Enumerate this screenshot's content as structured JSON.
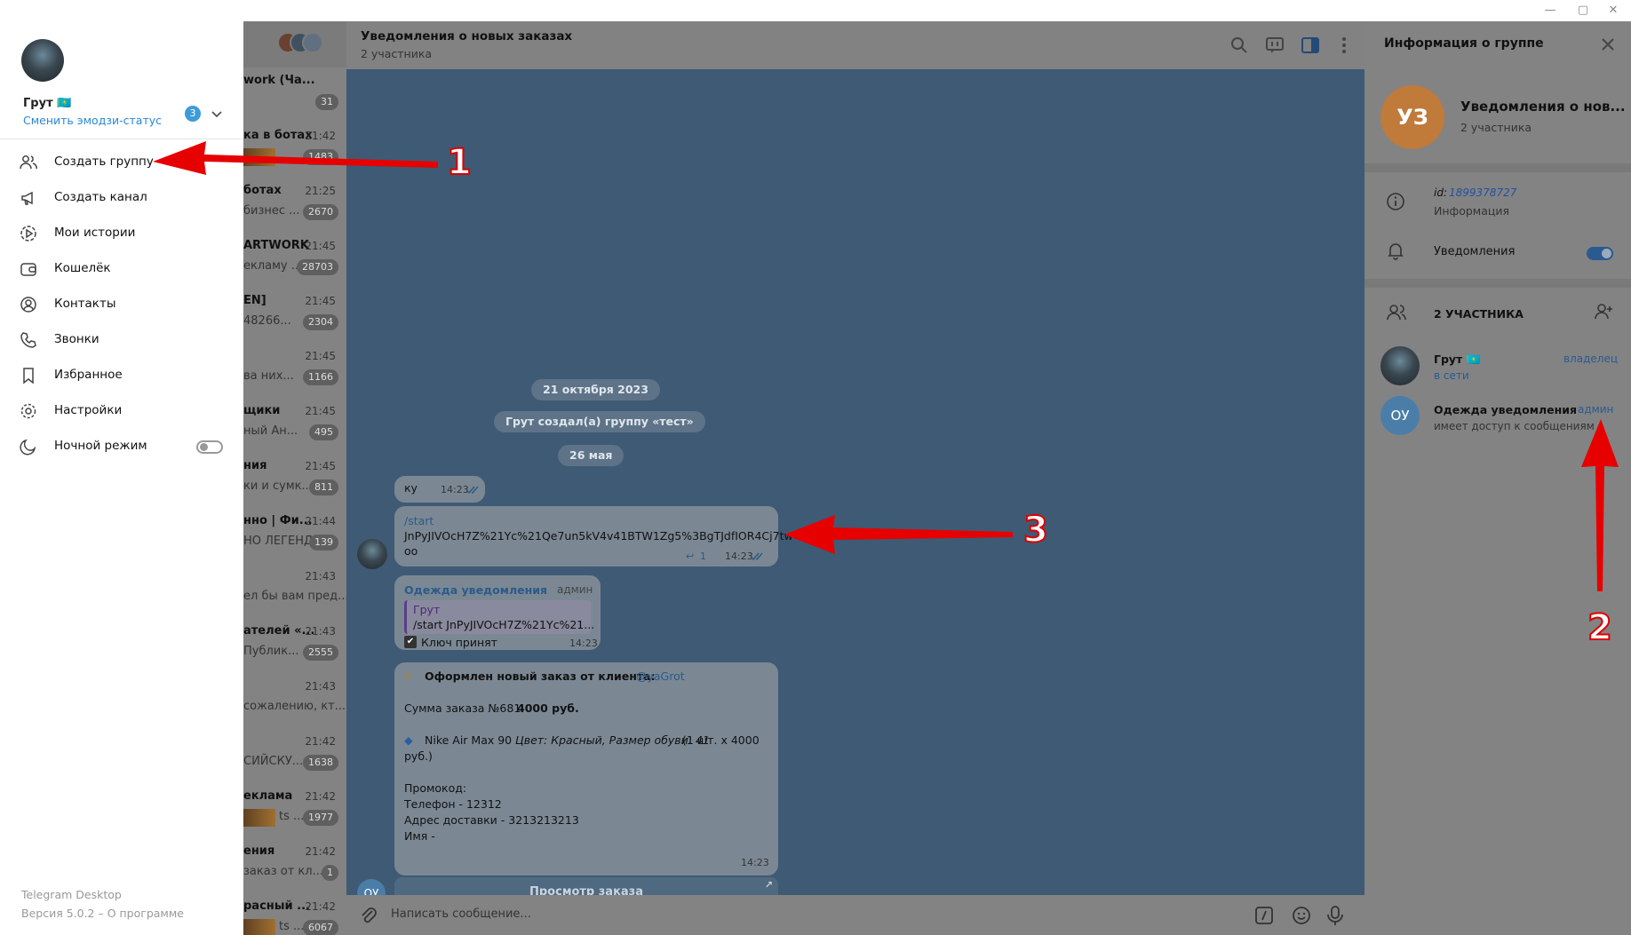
{
  "drawer": {
    "user_name": "Грут 🇰🇿",
    "emoji_status_link": "Сменить эмодзи-статус",
    "accounts_badge": "3",
    "menu": [
      {
        "label": "Создать группу"
      },
      {
        "label": "Создать канал"
      },
      {
        "label": "Мои истории"
      },
      {
        "label": "Кошелёк"
      },
      {
        "label": "Контакты"
      },
      {
        "label": "Звонки"
      },
      {
        "label": "Избранное"
      },
      {
        "label": "Настройки"
      },
      {
        "label": "Ночной режим"
      }
    ],
    "app_name": "Telegram Desktop",
    "version": "Версия 5.0.2 – О программе"
  },
  "chatlist": {
    "items": [
      {
        "name": "work (Ча...",
        "time": "",
        "preview": "",
        "badge": "31"
      },
      {
        "name": "ка в ботах",
        "time": "21:42",
        "preview": "",
        "badge": "1483"
      },
      {
        "name": "ботах",
        "time": "21:25",
        "preview": "бизнес ...",
        "badge": "2670"
      },
      {
        "name": "ARTWORK",
        "time": "21:45",
        "preview": "екламу ...",
        "badge": "28703"
      },
      {
        "name": "EN]",
        "time": "21:45",
        "preview": "48266...",
        "badge": "2304"
      },
      {
        "name": "",
        "time": "21:45",
        "preview": "ва них...",
        "badge": "1166"
      },
      {
        "name": "щики",
        "time": "21:45",
        "preview": "ный Ан...",
        "badge": "495"
      },
      {
        "name": "ния",
        "time": "21:45",
        "preview": "ки и сумк...",
        "badge": "811"
      },
      {
        "name": "нно | Фи...",
        "time": "21:44",
        "preview": "НО ЛЕГЕНД...",
        "badge": "139"
      },
      {
        "name": "",
        "time": "21:43",
        "preview": "ел бы вам пред...",
        "badge": ""
      },
      {
        "name": "ателей «...",
        "time": "21:43",
        "preview": "Публик...",
        "badge": "2555"
      },
      {
        "name": "",
        "time": "21:43",
        "preview": "сожалению, кт...",
        "badge": ""
      },
      {
        "name": "",
        "time": "21:42",
        "preview": "СИЙСКУ...",
        "badge": "1638"
      },
      {
        "name": "еклама",
        "time": "21:42",
        "preview": "ts ...",
        "badge": "1977"
      },
      {
        "name": "ения",
        "time": "21:42",
        "preview": "заказ от кл...",
        "badge": "1"
      },
      {
        "name": "расный ...",
        "time": "21:42",
        "preview": "ts ...",
        "badge": "6067"
      }
    ]
  },
  "chat": {
    "title": "Уведомления о новых заказах",
    "subtitle": "2 участника",
    "date1": "21 октября 2023",
    "service": "Грут создал(а) группу «тест»",
    "date2": "26 мая",
    "msg1": {
      "text": "ку",
      "time": "14:23"
    },
    "msg2": {
      "command": "/start",
      "line1": "JnPyJIVOcH7Z%21Yc%21Qe7un5kV4v41BTW1Zg5%3BgTJdfIOR4Cj7tw",
      "line2": "oo",
      "replies": "1",
      "time": "14:23"
    },
    "msg3": {
      "author": "Одежда уведомления",
      "role": "админ",
      "quote_author": "Грут",
      "quote_text": "/start JnPyJIVOcH7Z%21Yc%21...",
      "text": "Ключ принят",
      "time": "14:23"
    },
    "msg4": {
      "line_title": "Оформлен новый заказ от клиента:",
      "mention": "@yaGrot",
      "line_sum_label": "Сумма заказа №681:",
      "line_sum_value": "4000 руб.",
      "item_name": "Nike Air Max 90",
      "item_attrs": "Цвет: Красный, Размер обуви: 41",
      "item_qty": "(1 шт. x 4000",
      "item_qty2": "руб.)",
      "promo": "Промокод:",
      "phone": "Телефон - 12312",
      "address": "Адрес доставки - 3213213213",
      "name": "Имя -",
      "time": "14:23",
      "button": "Просмотр заказа"
    },
    "sender_avatar": "ОУ",
    "composer_placeholder": "Написать сообщение..."
  },
  "info": {
    "title": "Информация о группе",
    "avatar_initials": "УЗ",
    "group_name": "Уведомления о нов...",
    "group_sub": "2 участника",
    "id_label": "id:",
    "id_value": "1899378727",
    "info_label": "Информация",
    "notifications_label": "Уведомления",
    "members_header": "2 УЧАСТНИКА",
    "members": [
      {
        "name": "Грут 🇰🇿",
        "status": "в сети",
        "role": "владелец"
      },
      {
        "name": "Одежда уведомления",
        "status": "имеет доступ к сообщениям",
        "role": "админ",
        "initials": "ОУ"
      }
    ]
  },
  "annotations": [
    "1",
    "2",
    "3"
  ],
  "colors": {
    "accent": "#2a87d8",
    "arrow": "#e60000",
    "chat_bg": "#3f5a74"
  }
}
